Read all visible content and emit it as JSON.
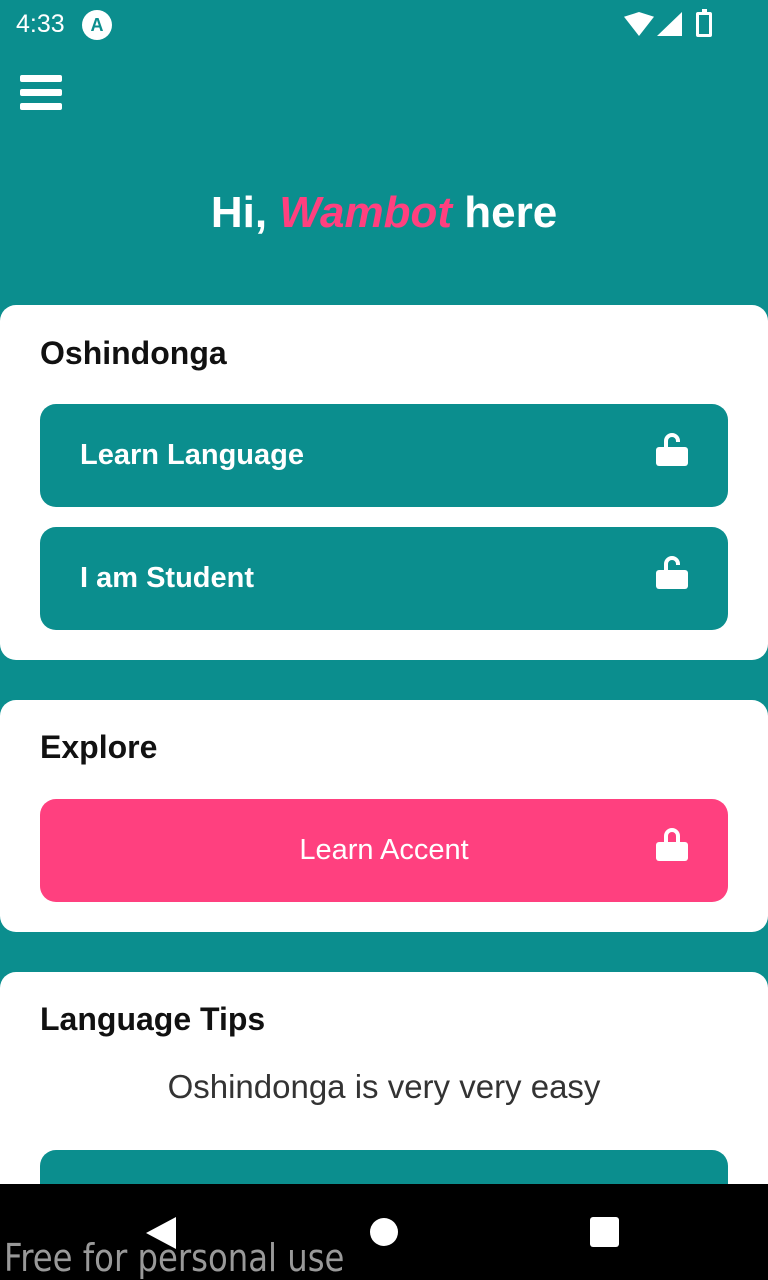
{
  "status_bar": {
    "time": "4:33",
    "app_icon": "A"
  },
  "header": {
    "greeting_prefix": "Hi, ",
    "name": "Wambot",
    "greeting_suffix": " here"
  },
  "sections": [
    {
      "title": "Oshindonga",
      "buttons": [
        {
          "label": "Learn Language",
          "icon": "lock-open-icon"
        },
        {
          "label": "I am Student",
          "icon": "lock-open-icon"
        }
      ]
    },
    {
      "title": "Explore",
      "buttons": [
        {
          "label": "Learn Accent",
          "icon": "lock-icon"
        }
      ]
    },
    {
      "title": "Language Tips",
      "tip": "Oshindonga is very very easy"
    }
  ],
  "watermark": "Free for personal use",
  "colors": {
    "primary": "#0b8e8e",
    "accent": "#ff407f"
  }
}
